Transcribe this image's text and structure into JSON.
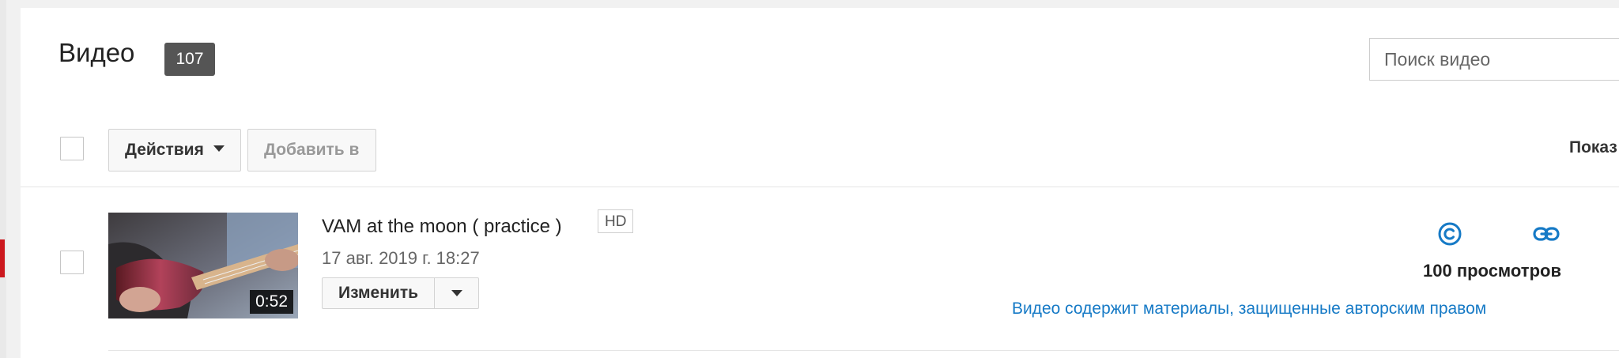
{
  "header": {
    "title": "Видео",
    "count": "107",
    "search_placeholder": "Поиск видео"
  },
  "toolbar": {
    "actions_label": "Действия",
    "add_to_label": "Добавить в",
    "show_label": "Показ"
  },
  "videos": [
    {
      "title": "VAM at the moon ( practice )",
      "quality_badge": "HD",
      "date": "17 авг. 2019 г. 18:27",
      "duration": "0:52",
      "edit_label": "Изменить",
      "views": "100 просмотров",
      "copyright_notice": "Видео содержит материалы, защищенные авторским правом"
    }
  ],
  "colors": {
    "accent_link": "#167ac6",
    "badge_bg": "#555555",
    "active_marker": "#cc181e"
  },
  "icons": [
    "copyright-icon",
    "link-icon",
    "chevron-down-icon"
  ]
}
